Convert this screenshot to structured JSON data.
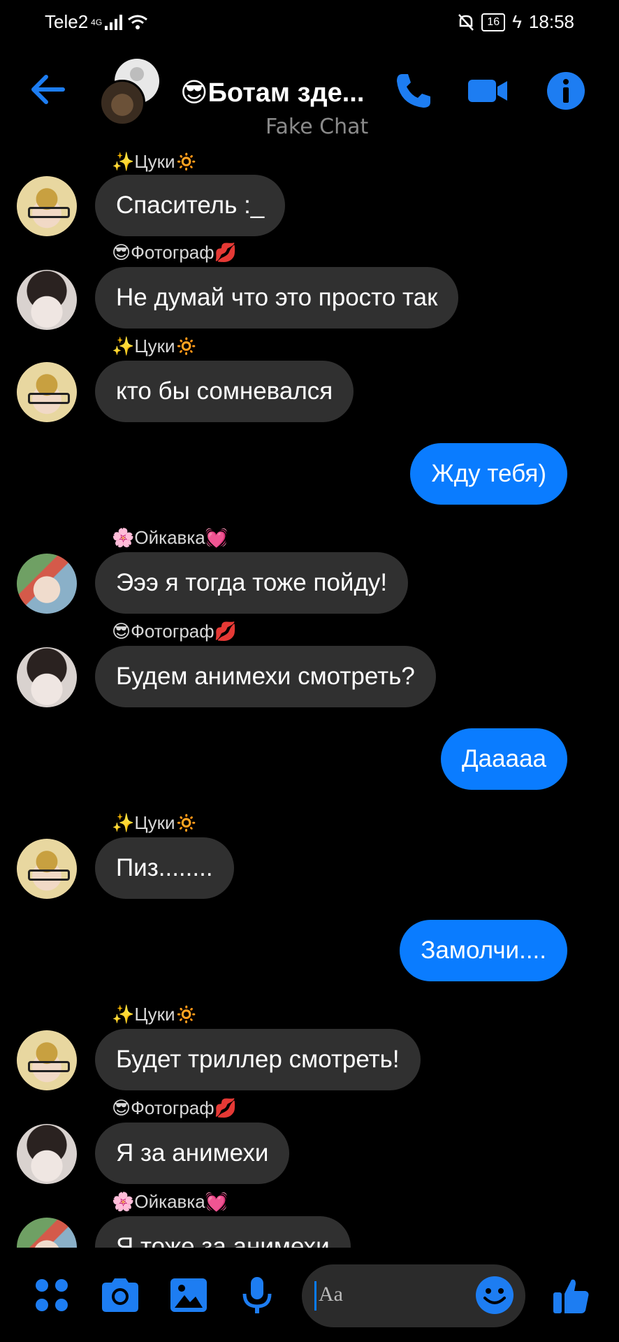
{
  "status_bar": {
    "carrier": "Tele2",
    "network": "4G",
    "battery": "16",
    "time": "18:58"
  },
  "header": {
    "title": "😎Ботам зде...",
    "subtitle": "Fake Chat",
    "icons": [
      "back-arrow-icon",
      "phone-icon",
      "video-camera-icon",
      "info-icon"
    ]
  },
  "messages": [
    {
      "sender": "✨Цуки🔅",
      "text": "Спаситель :_",
      "direction": "in",
      "avatar": "tsuki"
    },
    {
      "sender": "😎Фотограф💋",
      "text": "Не думай что это просто так",
      "direction": "in",
      "avatar": "photo"
    },
    {
      "sender": "✨Цуки🔅",
      "text": "кто бы сомневался",
      "direction": "in",
      "avatar": "tsuki"
    },
    {
      "text": "Жду тебя)",
      "direction": "out"
    },
    {
      "sender": "🌸Ойкавка💓",
      "text": "Эээ я тогда тоже пойду!",
      "direction": "in",
      "avatar": "oik"
    },
    {
      "sender": "😎Фотограф💋",
      "text": "Будем анимехи смотреть?",
      "direction": "in",
      "avatar": "photo"
    },
    {
      "text": "Дааааа",
      "direction": "out"
    },
    {
      "sender": "✨Цуки🔅",
      "text": "Пиз........",
      "direction": "in",
      "avatar": "tsuki"
    },
    {
      "text": "Замолчи....",
      "direction": "out"
    },
    {
      "sender": "✨Цуки🔅",
      "text": "Будет триллер смотреть!",
      "direction": "in",
      "avatar": "tsuki"
    },
    {
      "sender": "😎Фотограф💋",
      "text": "Я за анимехи",
      "direction": "in",
      "avatar": "photo"
    },
    {
      "sender": "🌸Ойкавка💓",
      "text": "Я тоже за анимехи",
      "direction": "in",
      "avatar": "oik"
    }
  ],
  "composer": {
    "placeholder": "Aa",
    "icons": [
      "menu-dots-icon",
      "camera-icon",
      "gallery-icon",
      "microphone-icon",
      "emoji-icon",
      "thumbs-up-icon"
    ]
  },
  "colors": {
    "accent": "#0a7cff",
    "incoming_bubble": "#303030",
    "background": "#000000"
  }
}
